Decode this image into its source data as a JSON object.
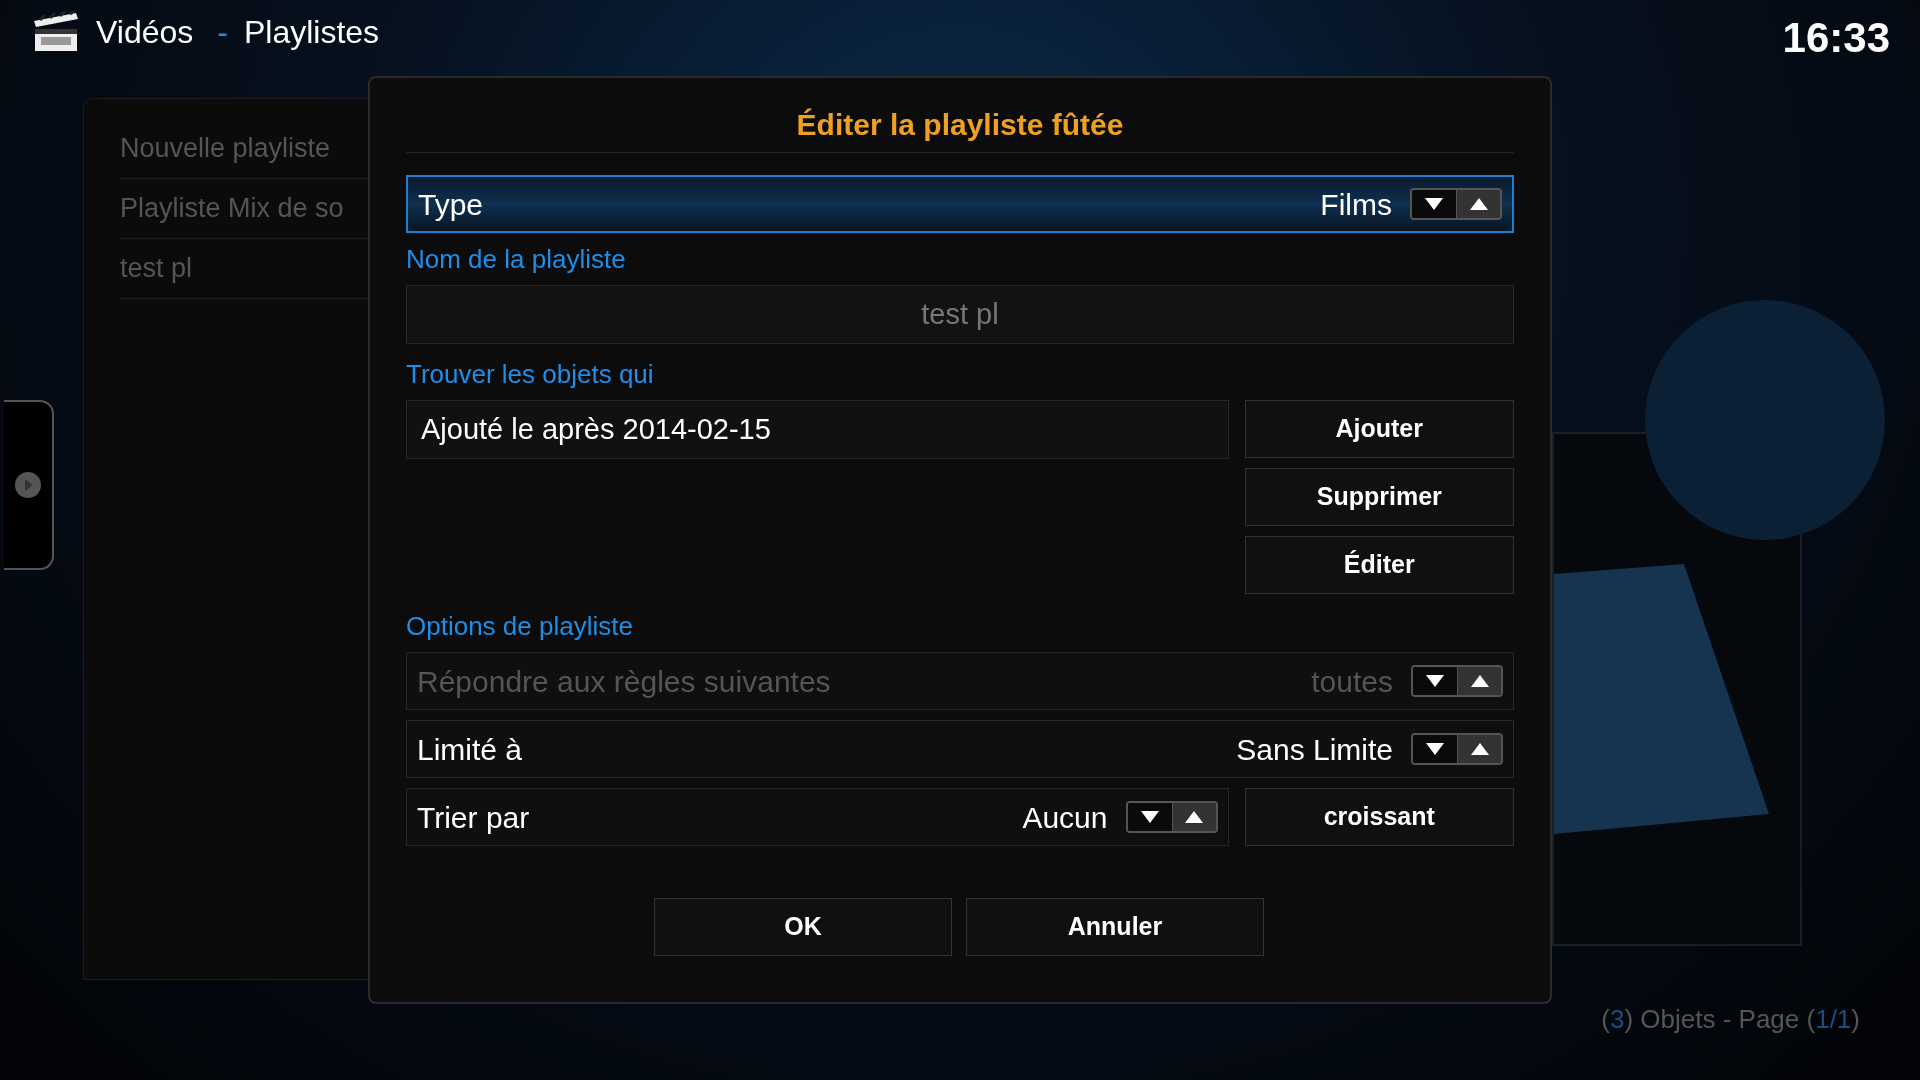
{
  "header": {
    "section": "Vidéos",
    "separator": "-",
    "subsection": "Playlistes"
  },
  "clock": "16:33",
  "playlist_list": [
    {
      "label": "Nouvelle playliste",
      "selected": false
    },
    {
      "label": "Playliste Mix de so",
      "selected": false
    },
    {
      "label": "test pl",
      "selected": false
    }
  ],
  "dialog": {
    "title": "Éditer la playliste fûtée",
    "type_row": {
      "label": "Type",
      "value": "Films",
      "selected": true,
      "disabled": false
    },
    "name_section": {
      "heading": "Nom de la playliste",
      "value": "test pl"
    },
    "rules_section": {
      "heading": "Trouver les objets qui",
      "rules": [
        {
          "label": "Ajouté le après 2014-02-15",
          "selected": false
        }
      ],
      "buttons": [
        "Ajouter",
        "Supprimer",
        "Éditer"
      ]
    },
    "options_section": {
      "heading": "Options de playliste",
      "rows": [
        {
          "label": "Répondre aux règles suivantes",
          "value": "toutes",
          "selected": false,
          "disabled": true
        },
        {
          "label": "Limité à",
          "value": "Sans Limite",
          "selected": false,
          "disabled": false
        }
      ],
      "sort": {
        "label": "Trier par",
        "value": "Aucun",
        "selected": false,
        "disabled": false,
        "order_button": "croissant"
      }
    },
    "buttons": [
      "OK",
      "Annuler"
    ]
  },
  "status": [
    {
      "text": "(",
      "kind": "plain"
    },
    {
      "text": "3",
      "kind": "accent"
    },
    {
      "text": ") Objets - Page (",
      "kind": "plain"
    },
    {
      "text": "1/1",
      "kind": "accent"
    },
    {
      "text": ")",
      "kind": "plain"
    }
  ]
}
